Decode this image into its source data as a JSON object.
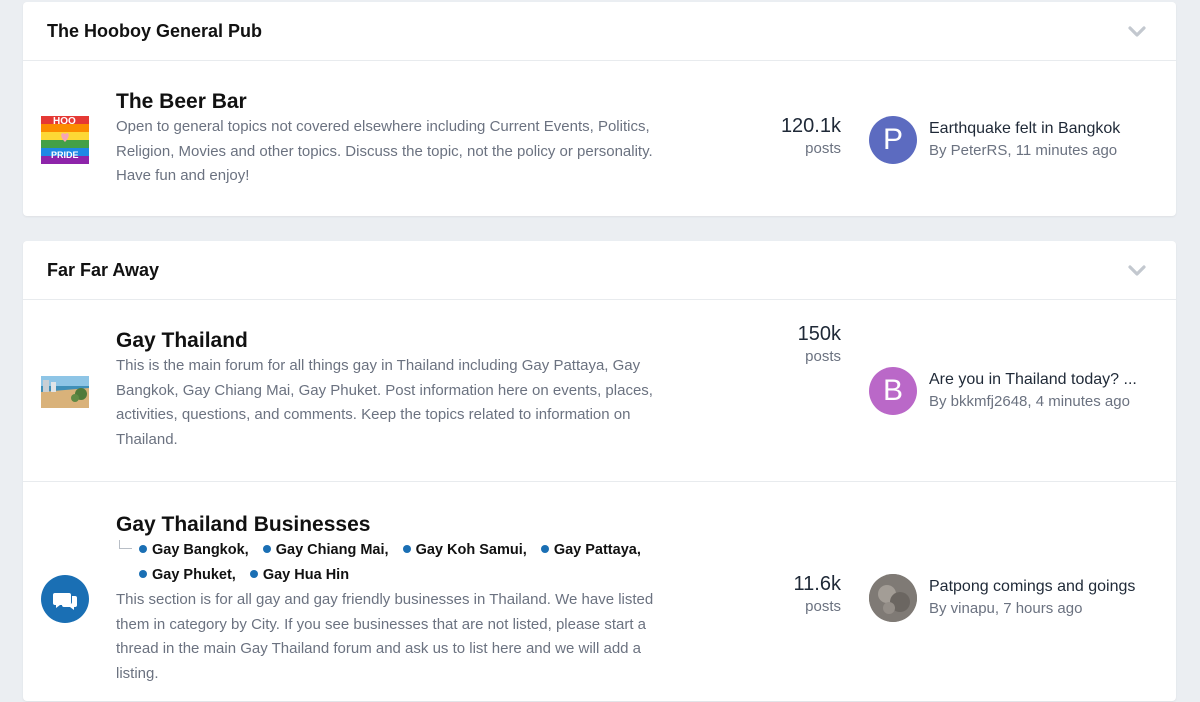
{
  "sections": [
    {
      "title": "The Hooboy General Pub",
      "forums": [
        {
          "title": "The Beer Bar",
          "desc_lines": [
            "Open to general topics not covered elsewhere including Current Events, Politics,",
            "Religion, Movies and other topics. Discuss the topic, not the policy or personality.",
            "Have fun and enjoy!"
          ],
          "posts": "120.1k",
          "posts_label": "posts",
          "icon_text_top": "HOO",
          "icon_text_bottom": "PRIDE",
          "last_title": "Earthquake felt in Bangkok",
          "last_by": "By PeterRS, 11 minutes ago",
          "avatar_letter": "P",
          "avatar_color": "#5c6bc0"
        }
      ]
    },
    {
      "title": "Far Far Away",
      "forums": [
        {
          "title": "Gay Thailand",
          "desc_lines": [
            "This is the main forum for all things gay in Thailand including Gay Pattaya, Gay",
            "Bangkok, Gay Chiang Mai, Gay Phuket. Post information here on events, places,",
            "activities, questions, and comments. Keep the topics related to information on",
            "Thailand."
          ],
          "posts": "150k",
          "posts_label": "posts",
          "last_title": "Are you in Thailand today? ...",
          "last_by": "By bkkmfj2648, 4 minutes ago",
          "avatar_letter": "B",
          "avatar_color": "#ba68c8"
        },
        {
          "title": "Gay Thailand Businesses",
          "subforums": [
            "Gay Bangkok,",
            "Gay Chiang Mai,",
            "Gay Koh Samui,",
            "Gay Pattaya,",
            "Gay Phuket,",
            "Gay Hua Hin"
          ],
          "desc_lines": [
            "This section is for all gay and gay friendly businesses in Thailand. We have listed",
            "them in category by City. If you see businesses that are not listed, please start a",
            "thread in the main Gay Thailand forum and ask us to list here and we will add a",
            "listing."
          ],
          "posts": "11.6k",
          "posts_label": "posts",
          "last_title": "Patpong comings and goings",
          "last_by": "By vinapu, 7 hours ago",
          "avatar_color": "#8a8580"
        }
      ]
    }
  ],
  "icons": {
    "chevron": "chevron-down-icon",
    "chat": "chat-bubbles-icon"
  },
  "colors": {
    "accent": "#1a6fb4",
    "page_bg": "#ebeef2"
  }
}
